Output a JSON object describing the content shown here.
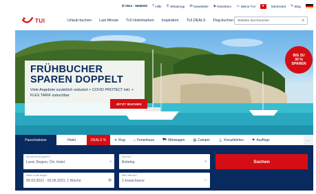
{
  "utility_bar": {
    "phone": "✆ 0511 - 5656000",
    "items": [
      {
        "icon": "help-icon",
        "glyph": "?",
        "label": "Hilfe"
      },
      {
        "icon": "whatsapp-icon",
        "glyph": "✆",
        "label": "WhatsApp"
      },
      {
        "icon": "mail-icon",
        "glyph": "✉",
        "label": "Newsletter"
      },
      {
        "icon": "store-icon",
        "glyph": "◈",
        "label": "Reisebüro"
      },
      {
        "icon": "user-icon",
        "glyph": "☺",
        "label": "Meine TUI"
      }
    ],
    "wishlist": {
      "glyph": "♥",
      "label": "Merkzettel"
    },
    "blog": {
      "glyph": "✎",
      "label": "Blog"
    },
    "flag_colors": [
      "#000000",
      "#dd0000",
      "#ffce00"
    ]
  },
  "header": {
    "logo_text": "TUI",
    "nav": [
      "Urlaub buchen",
      "Last Minute",
      "TUI Hotelmarken",
      "Inspiration",
      "TUI DEALS",
      "Flug buchen"
    ],
    "search_placeholder": "Website durchsuchen",
    "search_icon": "search-icon"
  },
  "hero": {
    "headline_1": "FRÜHBUCHER",
    "headline_2": "SPAREN DOPPELT",
    "subline": "Viele Angebote zusätzlich reduziert + COVID PROTECT inkl. + FLEX TARIF zubuchbar",
    "cta": "JETZT BUCHEN",
    "badge_line_1": "BIS ZU",
    "badge_line_2": "30 %",
    "badge_line_3": "SPAREN"
  },
  "tabs": [
    {
      "label": "Pauschalreise",
      "active": true
    },
    {
      "label": "Hotel"
    },
    {
      "label": "DEALS %",
      "highlight": true
    },
    {
      "label": "Flug",
      "glyph": "✈",
      "icon": "plane-icon"
    },
    {
      "label": "Ferienhaus",
      "glyph": "⌂",
      "icon": "house-icon"
    },
    {
      "label": "Mietwagen",
      "glyph": "⛟",
      "icon": "car-icon"
    },
    {
      "label": "Camper",
      "glyph": "▤",
      "icon": "camper-icon"
    },
    {
      "label": "Kreuzfahrten",
      "glyph": "⚓",
      "icon": "ship-icon"
    },
    {
      "label": "Ausflüge",
      "glyph": "⚑",
      "icon": "excursion-icon"
    }
  ],
  "more_tabs": "…",
  "search_form": {
    "origin_label": "Wo soll es hin gehen?",
    "origin_value": "Land, Region, Ort, Hotel",
    "from_label": "Von wo?",
    "from_value": "Beliebig",
    "date_label": "Wann & wie lange?",
    "date_value": "05.03.2021 - 03.06.2021, 1 Woche",
    "travellers_label": "Wer reist mit?",
    "travellers_value": "2 Erwachsene",
    "submit": "Suchen"
  },
  "colors": {
    "brand_navy": "#092a5e",
    "brand_red": "#d40e14"
  }
}
